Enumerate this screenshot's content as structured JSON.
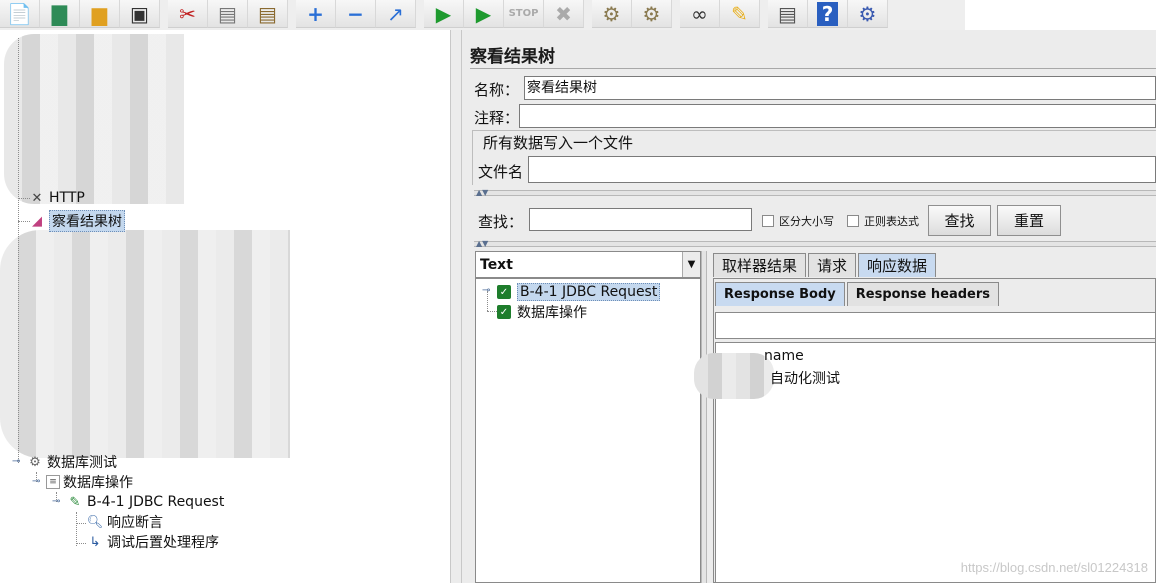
{
  "toolbar": {
    "buttons": [
      {
        "name": "new-icon",
        "glyph": "📄"
      },
      {
        "name": "templates-icon",
        "glyph": "📗"
      },
      {
        "name": "open-icon",
        "glyph": "📂"
      },
      {
        "name": "save-icon",
        "glyph": "💾"
      },
      {
        "name": "cut-icon",
        "glyph": "✂"
      },
      {
        "name": "copy-icon",
        "glyph": "📋"
      },
      {
        "name": "paste-icon",
        "glyph": "📋"
      },
      {
        "name": "expand-icon",
        "glyph": "+"
      },
      {
        "name": "collapse-icon",
        "glyph": "−"
      },
      {
        "name": "toggle-icon",
        "glyph": "⤴"
      },
      {
        "name": "start-icon",
        "glyph": "▶"
      },
      {
        "name": "start-no-pause-icon",
        "glyph": "▶"
      },
      {
        "name": "stop-icon",
        "glyph": "STOP"
      },
      {
        "name": "shutdown-icon",
        "glyph": "✖"
      },
      {
        "name": "clear-icon",
        "glyph": "🧹"
      },
      {
        "name": "clear-all-icon",
        "glyph": "🧹"
      },
      {
        "name": "search-binoculars-icon",
        "glyph": "🔭"
      },
      {
        "name": "reset-search-icon",
        "glyph": "🧹"
      },
      {
        "name": "function-helper-icon",
        "glyph": "▤"
      },
      {
        "name": "help-icon",
        "glyph": "?"
      },
      {
        "name": "remote-icon",
        "glyph": "⚙"
      }
    ]
  },
  "tree": {
    "partial_http_label": "HTTP",
    "view_results_tree_label": "察看结果树",
    "db_test_label": "数据库测试",
    "db_operation_label": "数据库操作",
    "jdbc_request_label": "B-4-1 JDBC Request",
    "response_assertion_label": "响应断言",
    "debug_postprocessor_label": "调试后置处理程序"
  },
  "panel": {
    "title": "察看结果树",
    "name_label": "名称：",
    "name_value": "察看结果树",
    "comment_label": "注释：",
    "comment_value": "",
    "file_group_legend": "所有数据写入一个文件",
    "filename_label": "文件名",
    "filename_value": ""
  },
  "search": {
    "label": "查找：",
    "value": "",
    "case_sensitive_label": "区分大小写",
    "regex_label": "正则表达式",
    "find_button": "查找",
    "reset_button": "重置"
  },
  "results": {
    "renderer_selected": "Text",
    "items": [
      {
        "label": "B-4-1 JDBC Request",
        "status": "success"
      },
      {
        "label": "数据库操作",
        "status": "success"
      }
    ]
  },
  "result_tabs": {
    "main": [
      "取样器结果",
      "请求",
      "响应数据"
    ],
    "main_active": "响应数据",
    "sub": [
      "Response Body",
      "Response headers"
    ],
    "sub_active": "Response Body"
  },
  "response": {
    "line1": "name",
    "line2": "自动化测试"
  },
  "watermark": "https://blog.csdn.net/sl01224318",
  "colors": {
    "selection": "#c4d8ee",
    "active_tab": "#c8daf0",
    "success_green": "#1e7d2c"
  }
}
